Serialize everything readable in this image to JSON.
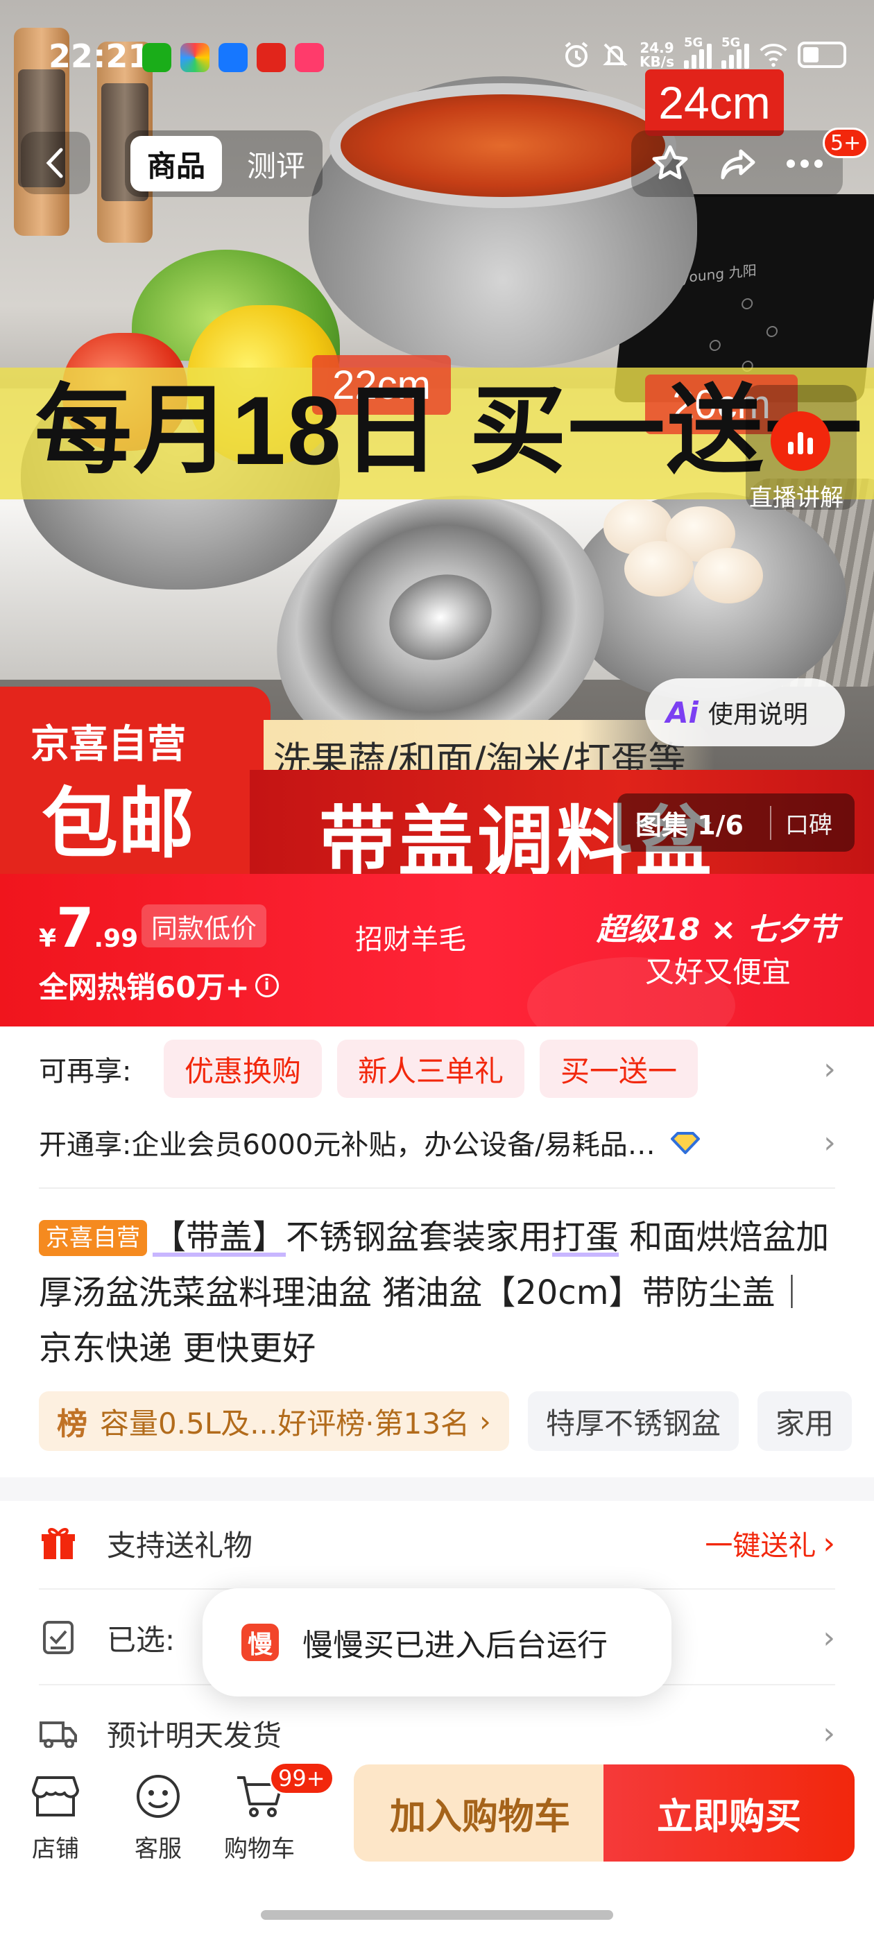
{
  "status_bar": {
    "time": "22:21",
    "net_speed_value": "24.9",
    "net_speed_unit": "KB/s",
    "sim1": "5G",
    "sim2": "5G",
    "battery_level": 0.35
  },
  "nav": {
    "tabs": [
      {
        "label": "商品",
        "active": true
      },
      {
        "label": "测评",
        "active": false
      }
    ],
    "more_badge": "5+"
  },
  "hero": {
    "size_tags": [
      "24cm",
      "22cm",
      "20cm"
    ],
    "promo_text": "每月18日 买一送一",
    "live_label": "直播讲解",
    "usage_label": "使用说明",
    "badge_line1": "京喜自营",
    "badge_line2": "包邮",
    "strip_text": "洗果蔬/和面/淘米/打蛋等",
    "banner_text": "带盖调料盆",
    "gallery_label": "图集 1/6",
    "koubei_label": "口碑",
    "cooktop_brand": "Joyoung 九阳"
  },
  "price_bar": {
    "currency": "¥",
    "price_int": "7",
    "price_dec": ".99",
    "same_low_tag": "同款低价",
    "hot_sale": "全网热销60万+",
    "info_icon": "i",
    "center_text": "招财羊毛",
    "festival_line1": "超级18 × 七夕节",
    "festival_line2": "又好又便宜"
  },
  "benefits": {
    "label": "可再享:",
    "chips": [
      "优惠换购",
      "新人三单礼",
      "买一送一"
    ],
    "open_label": "开通享:",
    "open_text": "企业会员6000元补贴，办公设备/易耗品…"
  },
  "product": {
    "store_tag": "京喜自营",
    "title_a": "【带盖】",
    "title_b": "不锈钢盆套装家用",
    "title_c": "打蛋",
    "title_d": " 和面烘焙盆加厚汤盆洗菜盆料理油盆 猪油盆【20cm】带防尘盖｜京东快递 更快更好",
    "rank_prefix": "榜",
    "rank_text": "容量0.5L及...好评榜·第13名",
    "rank_arrow": "›",
    "tags": [
      "特厚不锈钢盆",
      "家用"
    ]
  },
  "list": {
    "gift_text": "支持送礼物",
    "gift_action": "一键送礼",
    "selected_label": "已选:",
    "ship_text": "预计明天发货"
  },
  "toast": {
    "icon_char": "慢",
    "text": "慢慢买已进入后台运行"
  },
  "bottom_bar": {
    "store": "店铺",
    "service": "客服",
    "cart": "购物车",
    "cart_badge": "99+",
    "add_to_cart": "加入购物车",
    "buy_now": "立即购买"
  },
  "colors": {
    "jd_red": "#f2270c",
    "price_red": "#f0151d",
    "orange_tag": "#f58a1f",
    "add_cart_bg": "#fde6c8"
  }
}
